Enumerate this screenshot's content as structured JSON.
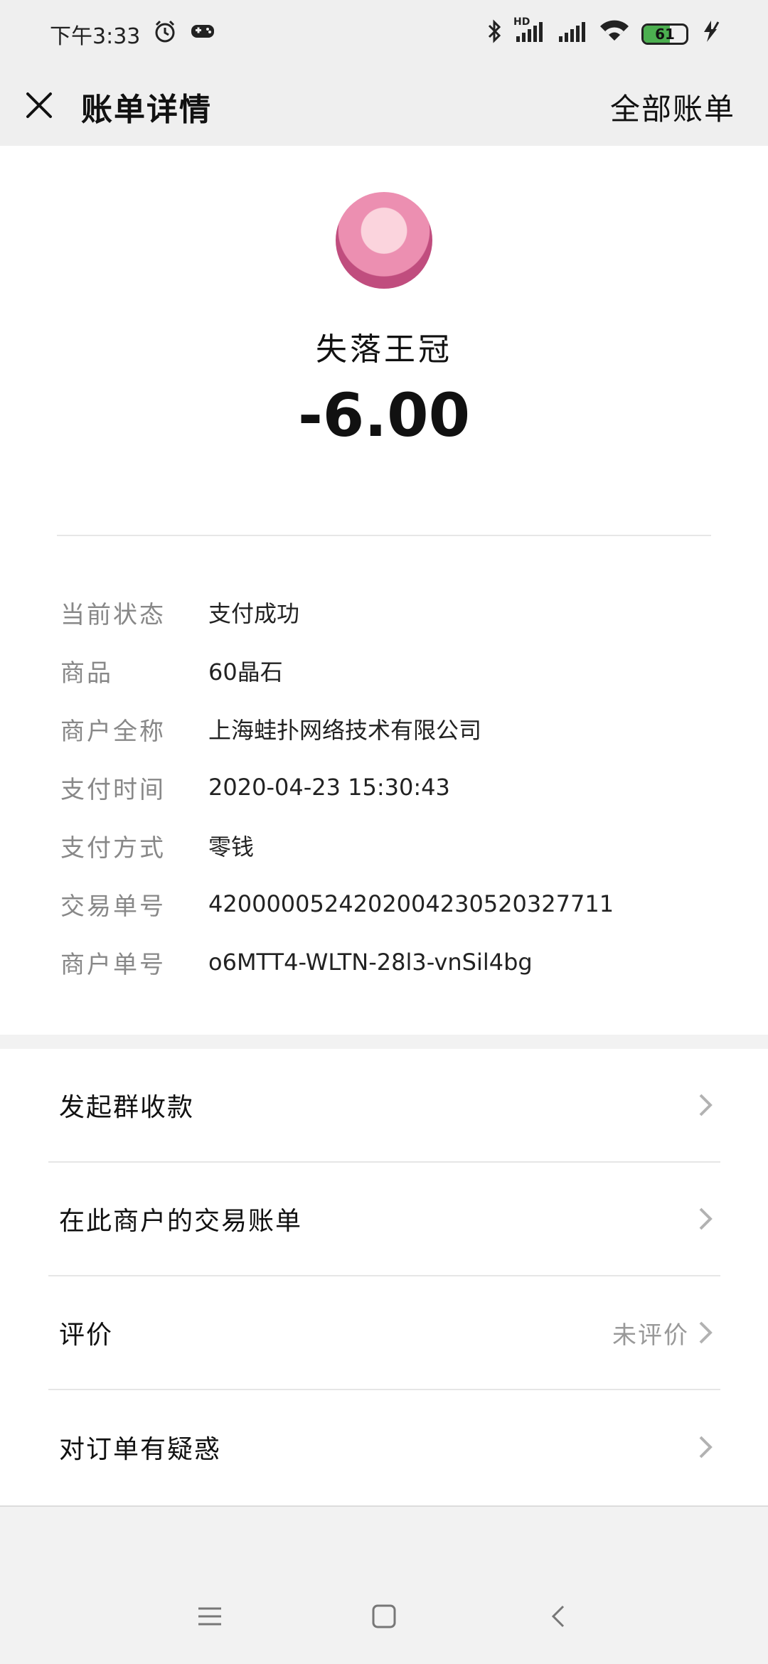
{
  "status_bar": {
    "time": "下午3:33",
    "network_label": "HD",
    "battery_level": "61",
    "battery_fraction": 0.61
  },
  "header": {
    "title": "账单详情",
    "right_link": "全部账单"
  },
  "merchant": {
    "name": "失落王冠",
    "amount": "-6.00"
  },
  "details": [
    {
      "label": "当前状态",
      "value": "支付成功"
    },
    {
      "label": "商品",
      "value": "60晶石"
    },
    {
      "label": "商户全称",
      "value": "上海蛙扑网络技术有限公司"
    },
    {
      "label": "支付时间",
      "value": "2020-04-23 15:30:43"
    },
    {
      "label": "支付方式",
      "value": "零钱"
    },
    {
      "label": "交易单号",
      "value": "4200000524202004230520327711"
    },
    {
      "label": "商户单号",
      "value": "o6MTT4-WLTN-28l3-vnSil4bg"
    }
  ],
  "actions": [
    {
      "label": "发起群收款",
      "sub": ""
    },
    {
      "label": "在此商户的交易账单",
      "sub": ""
    },
    {
      "label": "评价",
      "sub": "未评价"
    },
    {
      "label": "对订单有疑惑",
      "sub": ""
    }
  ],
  "icons": {
    "close": "close-icon",
    "chevron": "chevron-right-icon",
    "menu": "menu-icon",
    "home": "home-icon",
    "back": "back-icon"
  },
  "colors": {
    "header_bg": "#efefef",
    "card_bg": "#ffffff",
    "label_gray": "#888888",
    "battery_green": "#4caf50"
  }
}
